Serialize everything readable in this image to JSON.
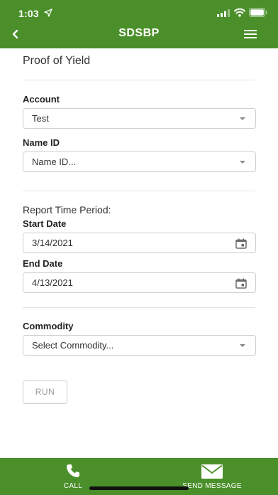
{
  "status_bar": {
    "time": "1:03"
  },
  "header": {
    "title": "SDSBP"
  },
  "page": {
    "title": "Proof of Yield",
    "account": {
      "label": "Account",
      "value": "Test"
    },
    "name_id": {
      "label": "Name ID",
      "placeholder": "Name ID..."
    },
    "report_period": {
      "label": "Report Time Period:",
      "start_label": "Start Date",
      "start_value": "3/14/2021",
      "end_label": "End Date",
      "end_value": "4/13/2021"
    },
    "commodity": {
      "label": "Commodity",
      "placeholder": "Select Commodity..."
    },
    "run_label": "RUN"
  },
  "bottom_bar": {
    "call_label": "CALL",
    "message_label": "SEND MESSAGE"
  },
  "colors": {
    "brand_green": "#4b8f2a"
  },
  "icons": [
    "location-arrow-icon",
    "signal-icon",
    "wifi-icon",
    "battery-icon",
    "back-chevron-icon",
    "hamburger-menu-icon",
    "calendar-icon",
    "phone-icon",
    "envelope-icon"
  ]
}
